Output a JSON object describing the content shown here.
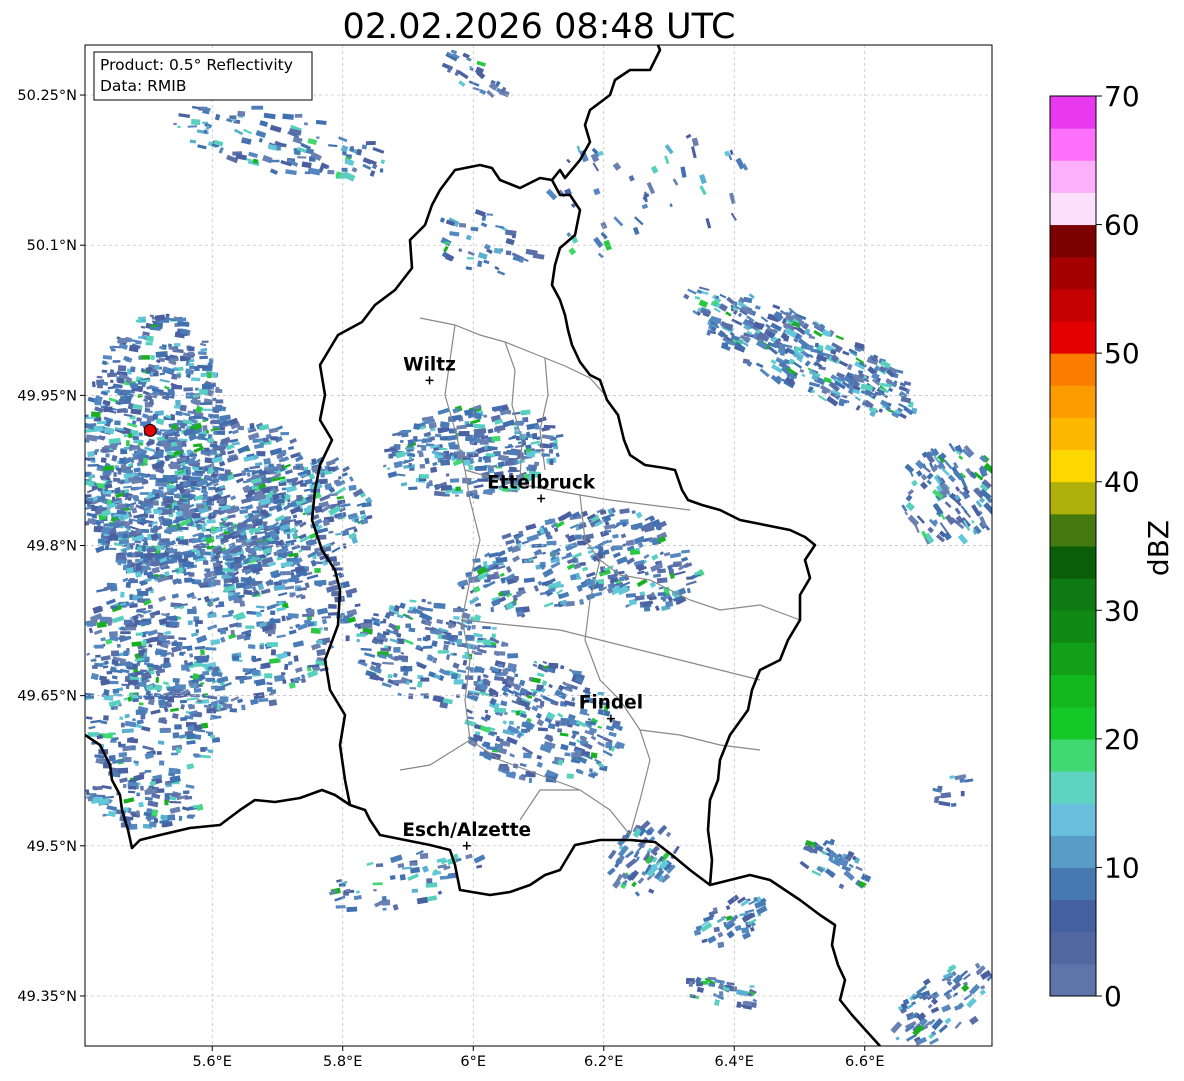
{
  "figure": {
    "title": "02.02.2026 08:48 UTC",
    "info_box": {
      "line1": "Product: 0.5° Reflectivity",
      "line2": "Data: RMIB"
    }
  },
  "map": {
    "lon_range": [
      5.405,
      6.795
    ],
    "lat_range": [
      49.3,
      50.3
    ],
    "lat_ticks": [
      {
        "value": 50.25,
        "label": "50.25°N"
      },
      {
        "value": 50.1,
        "label": "50.1°N"
      },
      {
        "value": 49.95,
        "label": "49.95°N"
      },
      {
        "value": 49.8,
        "label": "49.8°N"
      },
      {
        "value": 49.65,
        "label": "49.65°N"
      },
      {
        "value": 49.5,
        "label": "49.5°N"
      },
      {
        "value": 49.35,
        "label": "49.35°N"
      }
    ],
    "lon_ticks": [
      {
        "value": 5.6,
        "label": "5.6°E"
      },
      {
        "value": 5.8,
        "label": "5.8°E"
      },
      {
        "value": 6.0,
        "label": "6°E"
      },
      {
        "value": 6.2,
        "label": "6.2°E"
      },
      {
        "value": 6.4,
        "label": "6.4°E"
      },
      {
        "value": 6.6,
        "label": "6.6°E"
      }
    ],
    "grid": true,
    "cities": [
      {
        "name": "Wiltz",
        "lon": 5.933,
        "lat": 49.965
      },
      {
        "name": "Ettelbruck",
        "lon": 6.104,
        "lat": 49.847
      },
      {
        "name": "Findel",
        "lon": 6.211,
        "lat": 49.627
      },
      {
        "name": "Esch/Alzette",
        "lon": 5.99,
        "lat": 49.5
      }
    ],
    "radar_site": {
      "lon": 5.505,
      "lat": 49.915,
      "color": "#e00000"
    },
    "colorbar": {
      "label": "dBZ",
      "min": 0,
      "max": 70,
      "ticks": [
        {
          "value": 0,
          "label": "0"
        },
        {
          "value": 10,
          "label": "10"
        },
        {
          "value": 20,
          "label": "20"
        },
        {
          "value": 30,
          "label": "30"
        },
        {
          "value": 40,
          "label": "40"
        },
        {
          "value": 50,
          "label": "50"
        },
        {
          "value": 60,
          "label": "60"
        },
        {
          "value": 70,
          "label": "70"
        }
      ],
      "colors": [
        "#5f74a8",
        "#52679f",
        "#4560a0",
        "#4878b0",
        "#5a9cc8",
        "#68c0dc",
        "#5ed4c0",
        "#40d870",
        "#14c828",
        "#12b81e",
        "#12a01a",
        "#108a14",
        "#0e7a12",
        "#0a5e0a",
        "#447a10",
        "#b0b00c",
        "#fcd800",
        "#fcb800",
        "#fc9c00",
        "#fc7c00",
        "#e40000",
        "#c40000",
        "#a40000",
        "#7c0000",
        "#fde0fc",
        "#fcb0fc",
        "#fc70fc",
        "#e838f0"
      ]
    }
  }
}
